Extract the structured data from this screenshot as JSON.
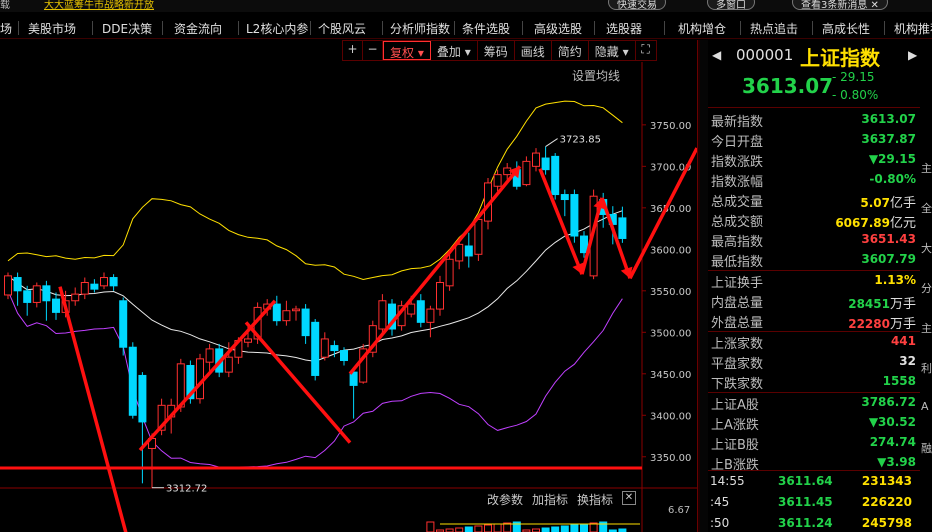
{
  "top_bar": {
    "left_label": "载",
    "ad_text": "大大蓝筹牛市战略新开放",
    "pills": [
      "快速交易",
      "多窗口",
      "查看3条新消息"
    ]
  },
  "menu": [
    "场",
    "美股市场",
    "DDE决策",
    "资金流向",
    "L2核心内参",
    "个股风云",
    "分析师指数",
    "条件选股",
    "高级选股",
    "选股器",
    "机构增仓",
    "热点追击",
    "高成长性",
    "机构推荐"
  ],
  "toolbar": {
    "buttons": [
      "+",
      "−",
      "复权",
      "叠加",
      "筹码",
      "画线",
      "简约",
      "隐藏"
    ],
    "active_label": "复权",
    "fullscreen_icon": "fullscreen-icon"
  },
  "ma_setting": "设置均线",
  "chart_data": {
    "type": "candlestick",
    "y_axis_labels": [
      3750,
      3700,
      3650,
      3600,
      3550,
      3500,
      3450,
      3400,
      3350
    ],
    "ylim": [
      3322,
      3792
    ],
    "candles": [
      {
        "o": 3545,
        "c": 3568,
        "h": 3572,
        "l": 3540
      },
      {
        "o": 3566,
        "c": 3550,
        "h": 3572,
        "l": 3532
      },
      {
        "o": 3550,
        "c": 3536,
        "h": 3556,
        "l": 3520
      },
      {
        "o": 3536,
        "c": 3556,
        "h": 3560,
        "l": 3530
      },
      {
        "o": 3556,
        "c": 3538,
        "h": 3562,
        "l": 3514
      },
      {
        "o": 3540,
        "c": 3524,
        "h": 3548,
        "l": 3515
      },
      {
        "o": 3524,
        "c": 3538,
        "h": 3550,
        "l": 3518
      },
      {
        "o": 3538,
        "c": 3546,
        "h": 3554,
        "l": 3532
      },
      {
        "o": 3546,
        "c": 3560,
        "h": 3566,
        "l": 3540
      },
      {
        "o": 3558,
        "c": 3552,
        "h": 3564,
        "l": 3548
      },
      {
        "o": 3556,
        "c": 3566,
        "h": 3572,
        "l": 3552
      },
      {
        "o": 3566,
        "c": 3556,
        "h": 3570,
        "l": 3550
      },
      {
        "o": 3538,
        "c": 3482,
        "h": 3542,
        "l": 3472
      },
      {
        "o": 3482,
        "c": 3400,
        "h": 3488,
        "l": 3396
      },
      {
        "o": 3448,
        "c": 3392,
        "h": 3452,
        "l": 3318
      },
      {
        "o": 3360,
        "c": 3372,
        "h": 3378,
        "l": 3312.72
      },
      {
        "o": 3382,
        "c": 3412,
        "h": 3420,
        "l": 3376
      },
      {
        "o": 3398,
        "c": 3412,
        "h": 3420,
        "l": 3378
      },
      {
        "o": 3410,
        "c": 3462,
        "h": 3468,
        "l": 3404
      },
      {
        "o": 3460,
        "c": 3420,
        "h": 3466,
        "l": 3414
      },
      {
        "o": 3420,
        "c": 3468,
        "h": 3474,
        "l": 3414
      },
      {
        "o": 3464,
        "c": 3480,
        "h": 3486,
        "l": 3450
      },
      {
        "o": 3480,
        "c": 3452,
        "h": 3486,
        "l": 3446
      },
      {
        "o": 3452,
        "c": 3470,
        "h": 3488,
        "l": 3446
      },
      {
        "o": 3470,
        "c": 3490,
        "h": 3494,
        "l": 3462
      },
      {
        "o": 3488,
        "c": 3492,
        "h": 3508,
        "l": 3482
      },
      {
        "o": 3492,
        "c": 3530,
        "h": 3536,
        "l": 3486
      },
      {
        "o": 3528,
        "c": 3534,
        "h": 3540,
        "l": 3520
      },
      {
        "o": 3534,
        "c": 3514,
        "h": 3544,
        "l": 3508
      },
      {
        "o": 3514,
        "c": 3526,
        "h": 3538,
        "l": 3508
      },
      {
        "o": 3526,
        "c": 3528,
        "h": 3532,
        "l": 3514
      },
      {
        "o": 3528,
        "c": 3496,
        "h": 3534,
        "l": 3486
      },
      {
        "o": 3512,
        "c": 3448,
        "h": 3516,
        "l": 3442
      },
      {
        "o": 3470,
        "c": 3492,
        "h": 3500,
        "l": 3466
      },
      {
        "o": 3484,
        "c": 3478,
        "h": 3490,
        "l": 3470
      },
      {
        "o": 3478,
        "c": 3466,
        "h": 3482,
        "l": 3460
      },
      {
        "o": 3452,
        "c": 3436,
        "h": 3456,
        "l": 3396
      },
      {
        "o": 3440,
        "c": 3480,
        "h": 3486,
        "l": 3438
      },
      {
        "o": 3476,
        "c": 3508,
        "h": 3514,
        "l": 3470
      },
      {
        "o": 3504,
        "c": 3538,
        "h": 3546,
        "l": 3498
      },
      {
        "o": 3534,
        "c": 3504,
        "h": 3540,
        "l": 3496
      },
      {
        "o": 3508,
        "c": 3532,
        "h": 3538,
        "l": 3502
      },
      {
        "o": 3522,
        "c": 3534,
        "h": 3544,
        "l": 3518
      },
      {
        "o": 3538,
        "c": 3512,
        "h": 3546,
        "l": 3506
      },
      {
        "o": 3512,
        "c": 3528,
        "h": 3532,
        "l": 3494
      },
      {
        "o": 3528,
        "c": 3560,
        "h": 3568,
        "l": 3520
      },
      {
        "o": 3556,
        "c": 3588,
        "h": 3596,
        "l": 3550
      },
      {
        "o": 3586,
        "c": 3606,
        "h": 3612,
        "l": 3576
      },
      {
        "o": 3604,
        "c": 3592,
        "h": 3620,
        "l": 3578
      },
      {
        "o": 3594,
        "c": 3636,
        "h": 3642,
        "l": 3586
      },
      {
        "o": 3634,
        "c": 3680,
        "h": 3686,
        "l": 3624
      },
      {
        "o": 3676,
        "c": 3690,
        "h": 3696,
        "l": 3670
      },
      {
        "o": 3690,
        "c": 3698,
        "h": 3704,
        "l": 3684
      },
      {
        "o": 3696,
        "c": 3676,
        "h": 3706,
        "l": 3672
      },
      {
        "o": 3678,
        "c": 3706,
        "h": 3712,
        "l": 3676
      },
      {
        "o": 3700,
        "c": 3716,
        "h": 3722,
        "l": 3694
      },
      {
        "o": 3710,
        "c": 3696,
        "h": 3723.85,
        "l": 3690
      },
      {
        "o": 3712,
        "c": 3666,
        "h": 3716,
        "l": 3660
      },
      {
        "o": 3666,
        "c": 3660,
        "h": 3672,
        "l": 3640
      },
      {
        "o": 3666,
        "c": 3616,
        "h": 3672,
        "l": 3608
      },
      {
        "o": 3616,
        "c": 3596,
        "h": 3622,
        "l": 3590
      },
      {
        "o": 3568,
        "c": 3664,
        "h": 3672,
        "l": 3564
      },
      {
        "o": 3660,
        "c": 3642,
        "h": 3668,
        "l": 3626
      },
      {
        "o": 3642,
        "c": 3630,
        "h": 3652,
        "l": 3606
      },
      {
        "o": 3637.87,
        "c": 3613.07,
        "h": 3651.43,
        "l": 3607.79
      }
    ],
    "annotations": [
      {
        "label": "3723.85",
        "value": 3723.85
      },
      {
        "label": "3312.72",
        "value": 3312.72
      }
    ]
  },
  "volume_tools": [
    "改参数",
    "加指标",
    "换指标"
  ],
  "volume_scale": "6.67",
  "quote": {
    "code": "000001",
    "name": "上证指数",
    "price": "3613.07",
    "change": "- 29.15",
    "change_pct": "- 0.80%",
    "rows_a": [
      {
        "k": "最新指数",
        "v": "3613.07",
        "color": "#22d24a"
      },
      {
        "k": "今日开盘",
        "v": "3637.87",
        "color": "#22d24a"
      },
      {
        "k": "指数涨跌",
        "v": "▼29.15",
        "color": "#22d24a"
      },
      {
        "k": "指数涨幅",
        "v": "-0.80%",
        "color": "#22d24a"
      },
      {
        "k": "总成交量",
        "v": "5.07",
        "u": "亿手",
        "color": "#ffe000"
      },
      {
        "k": "总成交额",
        "v": "6067.89",
        "u": "亿元",
        "color": "#ffe000"
      },
      {
        "k": "最高指数",
        "v": "3651.43",
        "color": "#ff4040"
      },
      {
        "k": "最低指数",
        "v": "3607.79",
        "color": "#22d24a"
      }
    ],
    "rows_b": [
      {
        "k": "上证换手",
        "v": "1.13%",
        "color": "#ffe000"
      },
      {
        "k": "内盘总量",
        "v": "28451",
        "u": "万手",
        "color": "#22d24a"
      },
      {
        "k": "外盘总量",
        "v": "22280",
        "u": "万手",
        "color": "#ff4040"
      }
    ],
    "rows_c": [
      {
        "k": "上涨家数",
        "v": "441",
        "color": "#ff4040"
      },
      {
        "k": "平盘家数",
        "v": "32",
        "color": "#e0e0e0"
      },
      {
        "k": "下跌家数",
        "v": "1558",
        "color": "#22d24a"
      }
    ],
    "rows_d": [
      {
        "k": "上证A股",
        "v": "3786.72",
        "color": "#22d24a"
      },
      {
        "k": "上A涨跌",
        "v": "▼30.52",
        "color": "#22d24a"
      },
      {
        "k": "上证B股",
        "v": "274.74",
        "color": "#22d24a"
      },
      {
        "k": "上B涨跌",
        "v": "▼3.98",
        "color": "#22d24a"
      }
    ],
    "ticks": [
      {
        "t": "14:55",
        "p": "3611.64",
        "v": "231343"
      },
      {
        "t": ":45",
        "p": "3611.45",
        "v": "226220"
      },
      {
        "t": ":50",
        "p": "3611.24",
        "v": "245798"
      }
    ]
  },
  "right_clip": [
    "主",
    "全",
    "大",
    "分",
    "主",
    "利",
    "A",
    "融"
  ],
  "colors": {
    "up": "#ff3030",
    "down": "#00d8ff",
    "ma_white": "#e8e8e8",
    "ma_yellow": "#ffe000",
    "ma_purple": "#c040ff",
    "trend": "#ff1010"
  }
}
